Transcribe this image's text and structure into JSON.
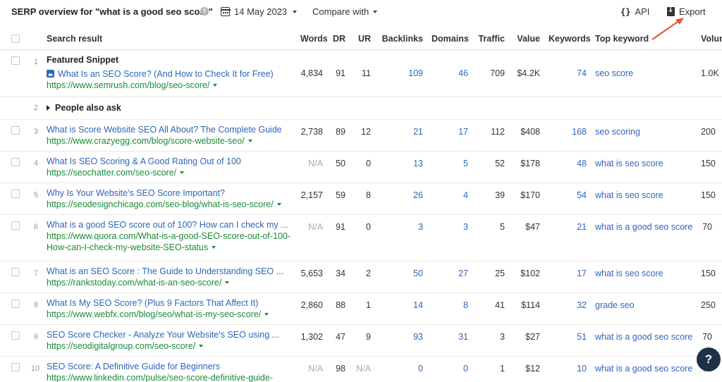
{
  "header": {
    "title": "SERP overview for \"what is a good seo score\"",
    "help_glyph": "?",
    "date": "14 May 2023",
    "compare_label": "Compare with",
    "api_glyph": "{}",
    "api_label": "API",
    "export_label": "Export"
  },
  "columns": {
    "search_result": "Search result",
    "words": "Words",
    "dr": "DR",
    "ur": "UR",
    "backlinks": "Backlinks",
    "domains": "Domains",
    "traffic": "Traffic",
    "value": "Value",
    "keywords": "Keywords",
    "top_keyword": "Top keyword",
    "volume": "Volume"
  },
  "featured": {
    "num": "1",
    "label": "Featured Snippet",
    "title": "What Is an SEO Score? (And How to Check It for Free)",
    "url": "https://www.semrush.com/blog/seo-score/",
    "words": "4,834",
    "dr": "91",
    "ur": "11",
    "backlinks": "109",
    "domains": "46",
    "traffic": "709",
    "value": "$4.2K",
    "keywords": "74",
    "top_keyword": "seo score",
    "volume": "1.0K"
  },
  "paa": {
    "num": "2",
    "label": "People also ask"
  },
  "rows": [
    {
      "num": "3",
      "title": "What is Score Website SEO All About? The Complete Guide",
      "url": "https://www.crazyegg.com/blog/score-website-seo/",
      "words": "2,738",
      "dr": "89",
      "ur": "12",
      "backlinks": "21",
      "domains": "17",
      "traffic": "112",
      "value": "$408",
      "keywords": "168",
      "top_keyword": "seo scoring",
      "volume": "200"
    },
    {
      "num": "4",
      "title": "What Is SEO Scoring & A Good Rating Out of 100",
      "url": "https://seochatter.com/seo-score/",
      "words": "N/A",
      "dr": "50",
      "ur": "0",
      "backlinks": "13",
      "domains": "5",
      "traffic": "52",
      "value": "$178",
      "keywords": "48",
      "top_keyword": "what is seo score",
      "volume": "150"
    },
    {
      "num": "5",
      "title": "Why Is Your Website's SEO Score Important?",
      "url": "https://seodesignchicago.com/seo-blog/what-is-seo-score/",
      "words": "2,157",
      "dr": "59",
      "ur": "8",
      "backlinks": "26",
      "domains": "4",
      "traffic": "39",
      "value": "$170",
      "keywords": "54",
      "top_keyword": "what is seo score",
      "volume": "150"
    },
    {
      "num": "6",
      "title": "What is a good SEO score out of 100? How can I check my ...",
      "url": "https://www.quora.com/What-is-a-good-SEO-score-out-of-100-How-can-I-check-my-website-SEO-status",
      "words": "N/A",
      "dr": "91",
      "ur": "0",
      "backlinks": "3",
      "domains": "3",
      "traffic": "5",
      "value": "$47",
      "keywords": "21",
      "top_keyword": "what is a good seo score",
      "volume": "70"
    },
    {
      "num": "7",
      "title": "What is an SEO Score : The Guide to Understanding SEO ...",
      "url": "https://rankstoday.com/what-is-an-seo-score/",
      "words": "5,653",
      "dr": "34",
      "ur": "2",
      "backlinks": "50",
      "domains": "27",
      "traffic": "25",
      "value": "$102",
      "keywords": "17",
      "top_keyword": "what is seo score",
      "volume": "150"
    },
    {
      "num": "8",
      "title": "What Is My SEO Score? (Plus 9 Factors That Affect It)",
      "url": "https://www.webfx.com/blog/seo/what-is-my-seo-score/",
      "words": "2,860",
      "dr": "88",
      "ur": "1",
      "backlinks": "14",
      "domains": "8",
      "traffic": "41",
      "value": "$114",
      "keywords": "32",
      "top_keyword": "grade seo",
      "volume": "250"
    },
    {
      "num": "9",
      "title": "SEO Score Checker - Analyze Your Website's SEO using ...",
      "url": "https://seodigitalgroup.com/seo-score/",
      "words": "1,302",
      "dr": "47",
      "ur": "9",
      "backlinks": "93",
      "domains": "31",
      "traffic": "3",
      "value": "$27",
      "keywords": "51",
      "top_keyword": "what is a good seo score",
      "volume": "70"
    },
    {
      "num": "10",
      "title": "SEO Score: A Definitive Guide for Beginners",
      "url": "https://www.linkedin.com/pulse/seo-score-definitive-guide-begin",
      "words": "N/A",
      "dr": "98",
      "ur": "N/A",
      "backlinks": "0",
      "domains": "0",
      "traffic": "1",
      "value": "$12",
      "keywords": "10",
      "top_keyword": "what is a good seo score",
      "volume": "70"
    }
  ],
  "help_button": "?",
  "colors": {
    "link": "#2e66b9",
    "url": "#1a8a3a",
    "arrow": "#e8562f",
    "help_bg": "#1f3146"
  }
}
